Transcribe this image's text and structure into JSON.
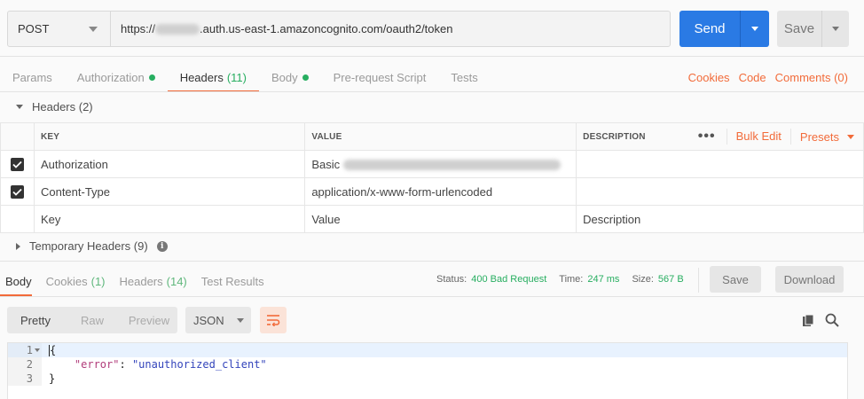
{
  "request": {
    "method": "POST",
    "url_prefix": "https://",
    "url_suffix": ".auth.us-east-1.amazoncognito.com/oauth2/token",
    "send_label": "Send",
    "save_label": "Save"
  },
  "request_tabs": [
    {
      "label": "Params",
      "count": ""
    },
    {
      "label": "Authorization",
      "count": ""
    },
    {
      "label": "Headers",
      "count": "(11)"
    },
    {
      "label": "Body",
      "count": ""
    },
    {
      "label": "Pre-request Script",
      "count": ""
    },
    {
      "label": "Tests",
      "count": ""
    }
  ],
  "right_links": {
    "cookies": "Cookies",
    "code": "Code",
    "comments": "Comments (0)"
  },
  "headers_section": {
    "title": "Headers (2)",
    "columns": {
      "key": "KEY",
      "value": "VALUE",
      "description": "DESCRIPTION"
    },
    "tools": {
      "more": "•••",
      "bulk_edit": "Bulk Edit",
      "presets": "Presets"
    },
    "rows": [
      {
        "key": "Authorization",
        "value": "Basic",
        "checked": true
      },
      {
        "key": "Content-Type",
        "value": "application/x-www-form-urlencoded",
        "checked": true
      }
    ],
    "placeholder": {
      "key": "Key",
      "value": "Value",
      "description": "Description"
    }
  },
  "temporary_headers": {
    "title": "Temporary Headers (9)",
    "info": "i"
  },
  "response_tabs": [
    {
      "label": "Body",
      "count": ""
    },
    {
      "label": "Cookies",
      "count": "(1)"
    },
    {
      "label": "Headers",
      "count": "(14)"
    },
    {
      "label": "Test Results",
      "count": ""
    }
  ],
  "status": {
    "status_label": "Status:",
    "status_value": "400 Bad Request",
    "time_label": "Time:",
    "time_value": "247 ms",
    "size_label": "Size:",
    "size_value": "567 B"
  },
  "response_actions": {
    "save": "Save",
    "download": "Download"
  },
  "format": {
    "pretty": "Pretty",
    "raw": "Raw",
    "preview": "Preview",
    "language": "JSON"
  },
  "code": {
    "line_numbers": [
      "1",
      "2",
      "3"
    ],
    "open_brace": "{",
    "key": "\"error\"",
    "colon": ": ",
    "value": "\"unauthorized_client\"",
    "close_brace": "}"
  },
  "colors": {
    "accent": "#f26b3a",
    "send": "#2a7ae4",
    "status_ok": "#27ae60"
  }
}
